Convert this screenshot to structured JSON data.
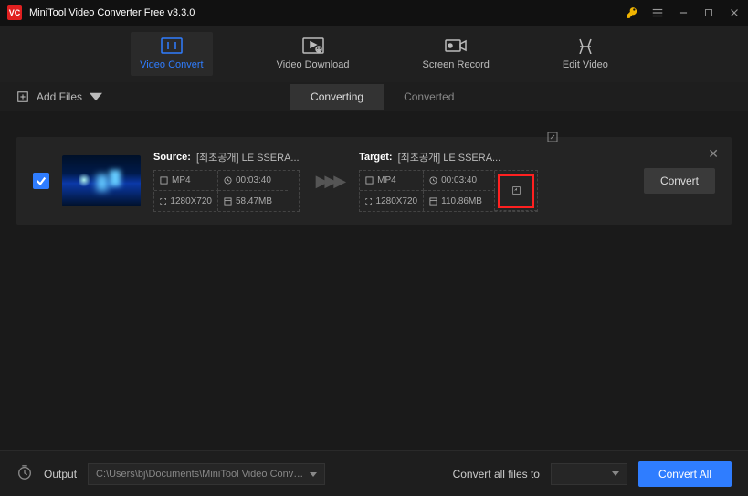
{
  "titlebar": {
    "title": "MiniTool Video Converter Free v3.3.0"
  },
  "nav": {
    "convert": "Video Convert",
    "download": "Video Download",
    "record": "Screen Record",
    "edit": "Edit Video"
  },
  "toolbar": {
    "addfiles": "Add Files",
    "tabs": {
      "converting": "Converting",
      "converted": "Converted"
    }
  },
  "task": {
    "sourceLabel": "Source:",
    "targetLabel": "Target:",
    "source": {
      "name": "[최초공개] LE SSERA...",
      "format": "MP4",
      "duration": "00:03:40",
      "resolution": "1280X720",
      "size": "58.47MB"
    },
    "target": {
      "name": "[최초공개] LE SSERA...",
      "format": "MP4",
      "duration": "00:03:40",
      "resolution": "1280X720",
      "size": "110.86MB"
    },
    "convert": "Convert"
  },
  "footer": {
    "output": "Output",
    "path": "C:\\Users\\bj\\Documents\\MiniTool Video Converter\\output",
    "convertAllTo": "Convert all files to",
    "convertAll": "Convert All"
  }
}
